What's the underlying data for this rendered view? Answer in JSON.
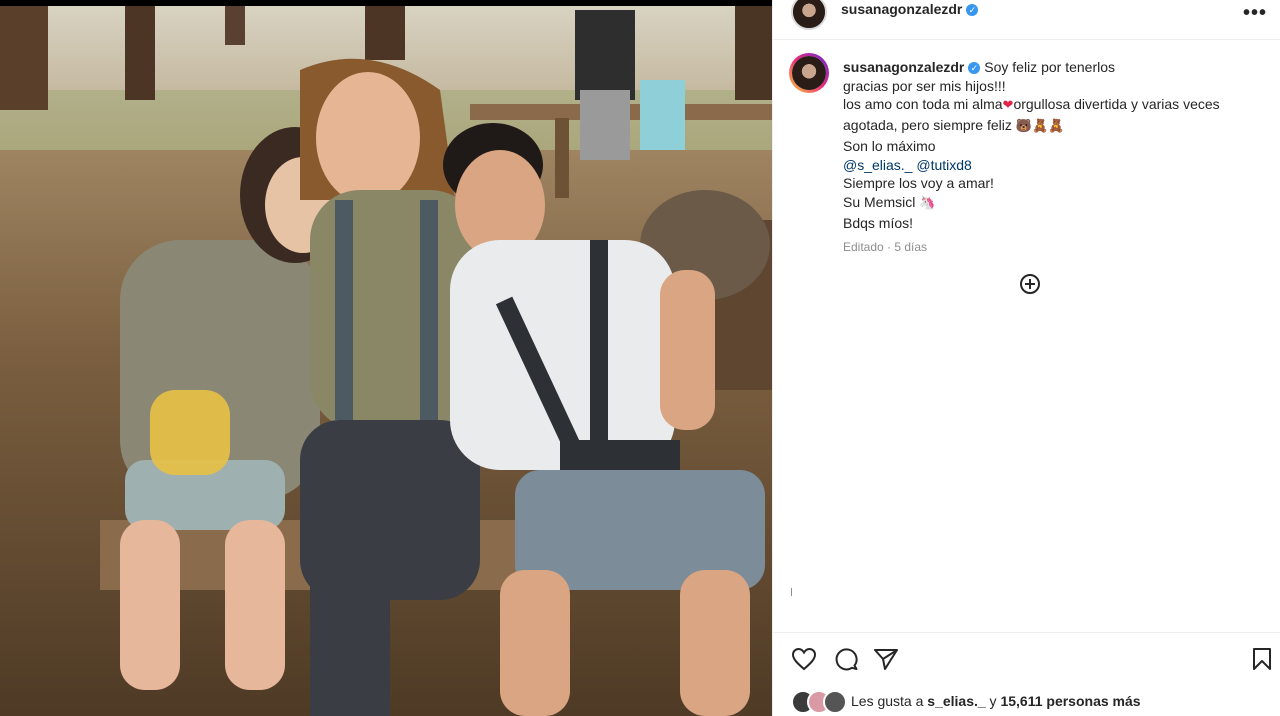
{
  "post": {
    "author": "susanagonzalezdr",
    "verified": true,
    "more_label": "•••"
  },
  "caption": {
    "author": "susanagonzalezdr",
    "first_line": "Soy feliz por tenerlos",
    "line2": "gracias por ser mis hijos!!!",
    "line3_a": "los amo con toda mi alma",
    "line3_heart": "❤",
    "line3_b": "orgullosa divertida y varias veces",
    "line4": "agotada, pero siempre feliz",
    "line4_emojis": [
      "🐻",
      "🧸",
      "🧸"
    ],
    "line5": "Son lo máximo",
    "mention1": "@s_elias._",
    "mention2": "@tutixd8",
    "line7": "Siempre los voy a amar!",
    "line8": "Su Memsicl",
    "line8_emoji": "🦄",
    "line9": "Bdqs míos!",
    "edited": "Editado · 5 días"
  },
  "icons": {
    "like": "heart-icon",
    "comment": "comment-icon",
    "share": "send-icon",
    "save": "bookmark-icon",
    "add": "plus-circle-icon"
  },
  "likes": {
    "prefix": "Les gusta a ",
    "user": "s_elias._",
    "connector": " y ",
    "count": "15,611 personas más"
  }
}
